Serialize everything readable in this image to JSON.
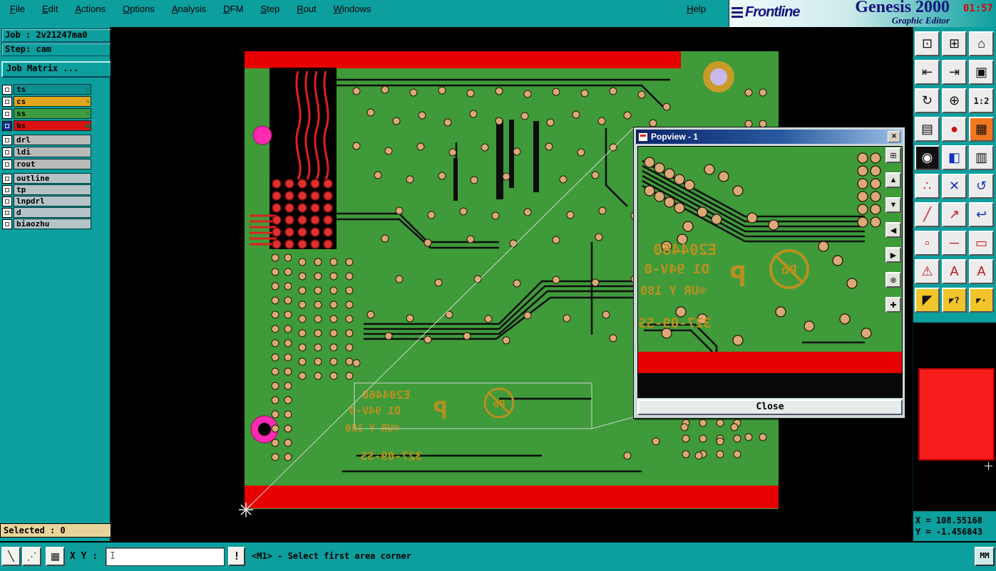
{
  "colors": {
    "teal": "#0d9e9e",
    "board_green": "#3f9a3a",
    "board_red": "#e60000",
    "gold_silk": "#b9901f",
    "magenta_pad": "#ff2ab2",
    "brand_navy": "#15157e",
    "selected_bg": "#e8d49a",
    "overview_red": "#f81b1b"
  },
  "menu": {
    "items": [
      {
        "k": "F",
        "rest": "ile"
      },
      {
        "k": "E",
        "rest": "dit"
      },
      {
        "k": "A",
        "rest": "ctions"
      },
      {
        "k": "O",
        "rest": "ptions"
      },
      {
        "k": "A",
        "rest": "nalysis"
      },
      {
        "k": "D",
        "rest": "FM"
      },
      {
        "k": "S",
        "rest": "tep"
      },
      {
        "k": "R",
        "rest": "out"
      },
      {
        "k": "W",
        "rest": "indows"
      }
    ],
    "help": {
      "k": "H",
      "rest": "elp"
    }
  },
  "brand": {
    "logo": "Frontline",
    "title": "Genesis 2000",
    "subtitle": "Graphic Editor",
    "time": "01:57"
  },
  "job": {
    "job_line": "Job : 2v21247ma0",
    "step_line": "Step: cam",
    "matrix_button": "Job Matrix ..."
  },
  "layers": {
    "color_rows": [
      {
        "name": "ts",
        "color": "#0c8f8f",
        "marks": "✎"
      },
      {
        "name": "cs",
        "color": "#e2a51c",
        "marks": "✎"
      },
      {
        "name": "ss",
        "color": "#3f9b3f",
        "marks": "✎"
      },
      {
        "name": "bs",
        "color": "#dd1111",
        "marks": "✎▦"
      }
    ],
    "gray_rows": [
      {
        "name": "drl"
      },
      {
        "name": "ldi"
      },
      {
        "name": "rout"
      }
    ],
    "misc_rows": [
      {
        "name": "outline"
      },
      {
        "name": "tp"
      },
      {
        "name": "lnpdrl"
      },
      {
        "name": "d"
      },
      {
        "name": "biaozhu"
      }
    ]
  },
  "board_text": {
    "part_no": "E204460",
    "rating": "D1 94V-0",
    "ur_line": "®UR Y 180",
    "logo_p": "P",
    "pb": "Pb",
    "serial": "327-09-SS"
  },
  "popview": {
    "title": "Popview - 1",
    "close_x": "✕",
    "close_button": "Close",
    "controls": [
      {
        "name": "pv-window-icon",
        "glyph": "⊞"
      },
      {
        "name": "pv-pan-up-icon",
        "glyph": "▲"
      },
      {
        "name": "pv-pan-down-icon",
        "glyph": "▼"
      },
      {
        "name": "pv-pan-left-icon",
        "glyph": "◀"
      },
      {
        "name": "pv-pan-right-icon",
        "glyph": "▶"
      },
      {
        "name": "pv-zoom-fit-icon",
        "glyph": "⊗"
      },
      {
        "name": "pv-center-icon",
        "glyph": "✚"
      }
    ]
  },
  "toolbar": {
    "buttons": [
      {
        "glyph": "⊡"
      },
      {
        "glyph": "⊞"
      },
      {
        "glyph": "⌂"
      },
      {
        "glyph": "⇤"
      },
      {
        "glyph": "⇥"
      },
      {
        "glyph": "▣"
      },
      {
        "glyph": "↻"
      },
      {
        "glyph": "⊕"
      },
      {
        "glyph": "1:2"
      },
      {
        "glyph": "▤"
      },
      {
        "glyph": "●"
      },
      {
        "glyph": "▦"
      },
      {
        "glyph": "◉"
      },
      {
        "glyph": "◧"
      },
      {
        "glyph": "▥"
      },
      {
        "glyph": "∴"
      },
      {
        "glyph": "✕"
      },
      {
        "glyph": "↺"
      },
      {
        "glyph": "╱"
      },
      {
        "glyph": "↗"
      },
      {
        "glyph": "↩"
      },
      {
        "glyph": "▫"
      },
      {
        "glyph": "─"
      },
      {
        "glyph": "▭"
      },
      {
        "glyph": "⚠"
      },
      {
        "glyph": "A"
      },
      {
        "glyph": "A"
      },
      {
        "glyph": "◤"
      },
      {
        "glyph": "◤?"
      },
      {
        "glyph": "◤·"
      }
    ]
  },
  "status": {
    "selected": "Selected : 0",
    "xy_label": "X Y :",
    "alert": "!",
    "message": "<M1> - Select first area corner",
    "units": "MM",
    "tools": [
      {
        "glyph": "╲"
      },
      {
        "glyph": "⋰"
      },
      {
        "glyph": "▦"
      }
    ]
  },
  "coords": {
    "x": "X = 108.55168",
    "y": "Y = -1.456843"
  }
}
